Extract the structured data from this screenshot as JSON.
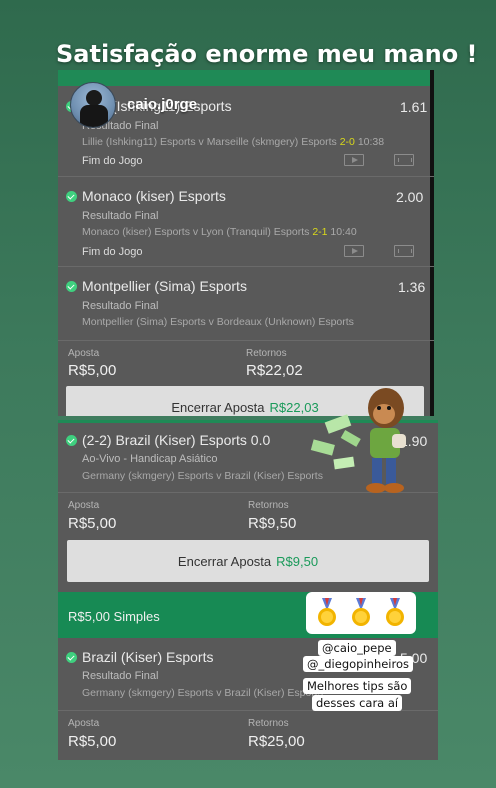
{
  "story": {
    "title": "Satisfação enorme meu mano !",
    "username": "caio.j0rge",
    "mentions": [
      "@caio_pepe",
      "@_diegopinheiros"
    ],
    "caption_lines": [
      "Melhores tips são",
      "desses cara aí"
    ]
  },
  "bet1": {
    "selections": [
      {
        "name": "(Ishking11) Esports",
        "odds": "1.61",
        "market": "Resultado Final",
        "fixture": "Lillie (Ishking11) Esports v Marseille (skmgery) Esports",
        "score": "2-0",
        "time": "10:38",
        "status": "Fim do Jogo"
      },
      {
        "name": "Monaco (kiser) Esports",
        "odds": "2.00",
        "market": "Resultado Final",
        "fixture": "Monaco (kiser) Esports v Lyon (Tranquil) Esports",
        "score": "2-1",
        "time": "10:40",
        "status": "Fim do Jogo"
      },
      {
        "name": "Montpellier (Sima) Esports",
        "odds": "1.36",
        "market": "Resultado Final",
        "fixture": "Montpellier (Sima) Esports v Bordeaux (Unknown) Esports"
      }
    ],
    "stake_label": "Aposta",
    "stake_value": "R$5,00",
    "returns_label": "Retornos",
    "returns_value": "R$22,02",
    "cashout_label": "Encerrar Aposta",
    "cashout_amount": "R$22,03"
  },
  "bet2": {
    "selection": {
      "name": "(2-2) Brazil (Kiser) Esports 0.0",
      "odds": "1.90",
      "market": "Ao-Vivo - Handicap Asiático",
      "fixture": "Germany (skmgery) Esports v Brazil (Kiser) Esports"
    },
    "stake_label": "Aposta",
    "stake_value": "R$5,00",
    "returns_label": "Retornos",
    "returns_value": "R$9,50",
    "cashout_label": "Encerrar Aposta",
    "cashout_amount": "R$9,50"
  },
  "bet3": {
    "header": "R$5,00 Simples",
    "selection": {
      "name": "Brazil (Kiser) Esports",
      "odds": "5.00",
      "market": "Resultado Final",
      "fixture": "Germany (skmgery) Esports v Brazil (Kiser) Esports"
    },
    "stake_label": "Aposta",
    "stake_value": "R$5,00",
    "returns_label": "Retornos",
    "returns_value": "R$25,00"
  },
  "colors": {
    "background": "#3d7a5c",
    "brand_green": "#178a54",
    "check_green": "#3fd07f",
    "score_yellow": "#d9d91a",
    "card_gray": "#595959"
  },
  "icons": [
    "check-circle-icon",
    "play-video-icon",
    "match-stats-icon",
    "medal-icon",
    "money-sticker-icon"
  ]
}
